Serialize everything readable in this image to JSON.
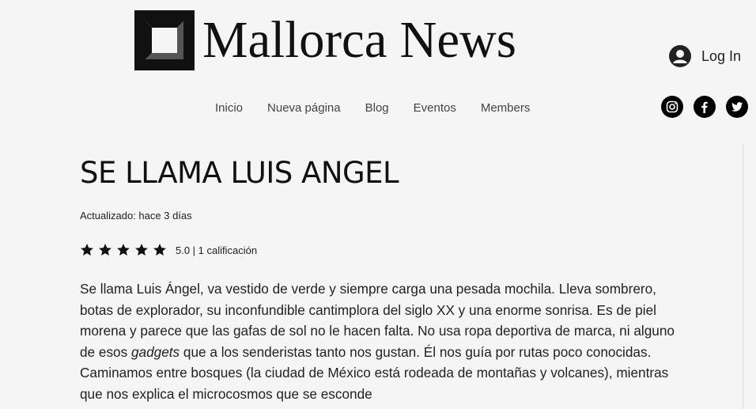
{
  "header": {
    "site_name": "Mallorca News",
    "login_label": "Log In",
    "nav": [
      {
        "label": "Inicio"
      },
      {
        "label": "Nueva página"
      },
      {
        "label": "Blog"
      },
      {
        "label": "Eventos"
      },
      {
        "label": "Members"
      }
    ],
    "social": [
      {
        "icon": "instagram-icon"
      },
      {
        "icon": "facebook-icon"
      },
      {
        "icon": "twitter-icon"
      }
    ]
  },
  "post": {
    "title": "SE LLAMA LUIS ANGEL",
    "updated": "Actualizado: hace 3 días",
    "rating": {
      "stars": 5,
      "max": 5,
      "text": "5.0 | 1 calificación"
    },
    "body": {
      "before_italic": "Se llama Luis Ángel, va vestido de verde y siempre carga una pesada mochila. Lleva sombrero, botas de explorador, su inconfundible cantimplora del siglo XX y una enorme sonrisa. Es de piel morena y parece que las gafas de sol no le hacen falta. No usa ropa deportiva de marca, ni alguno de esos ",
      "italic": "gadgets",
      "after_italic": " que a los senderistas tanto nos gustan. Él nos guía por rutas poco conocidas. Caminamos entre bosques (la ciudad de México está rodeada de montañas y volcanes), mientras que nos explica el microcosmos que se esconde"
    }
  },
  "colors": {
    "background": "#f5f5f5",
    "text": "#111111",
    "nav_text": "#444444",
    "icon_fill": "#000000"
  }
}
